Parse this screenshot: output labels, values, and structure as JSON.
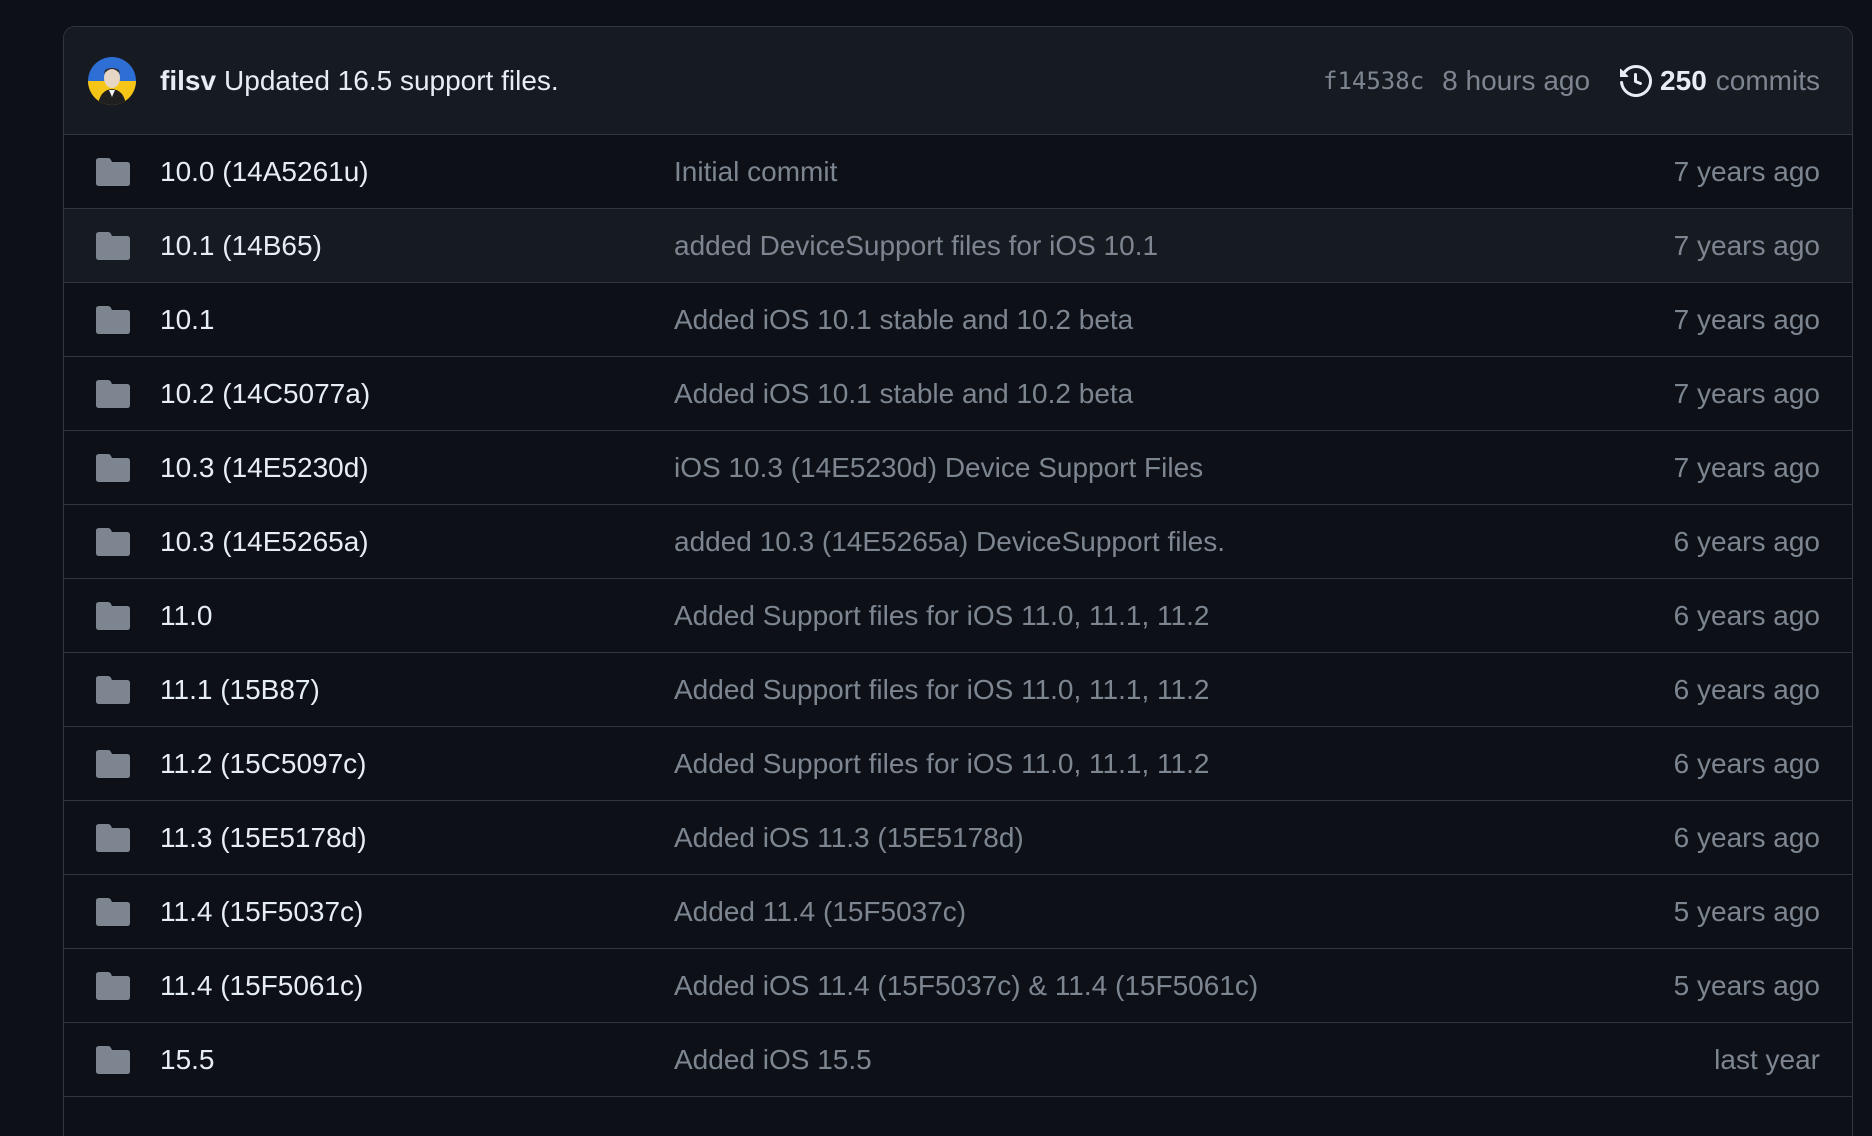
{
  "latest_commit": {
    "author": "filsv",
    "message": "Updated 16.5 support files.",
    "sha": "f14538c",
    "time": "8 hours ago",
    "commit_count": "250",
    "commit_label": "commits",
    "icons": {
      "avatar": "user-avatar",
      "history": "history-icon"
    }
  },
  "colors": {
    "background": "#0d1117",
    "header_background": "#161b22",
    "border": "#30363d",
    "primary_text": "#e6edf3",
    "muted_text": "#7d8590",
    "folder": "#7d8590"
  },
  "files": [
    {
      "name": "10.0 (14A5261u)",
      "message": "Initial commit",
      "age": "7 years ago",
      "icon": "folder-icon"
    },
    {
      "name": "10.1 (14B65)",
      "message": "added DeviceSupport files for iOS 10.1",
      "age": "7 years ago",
      "icon": "folder-icon"
    },
    {
      "name": "10.1",
      "message": "Added iOS 10.1 stable and 10.2 beta",
      "age": "7 years ago",
      "icon": "folder-icon"
    },
    {
      "name": "10.2 (14C5077a)",
      "message": "Added iOS 10.1 stable and 10.2 beta",
      "age": "7 years ago",
      "icon": "folder-icon"
    },
    {
      "name": "10.3 (14E5230d)",
      "message": "iOS 10.3 (14E5230d) Device Support Files",
      "age": "7 years ago",
      "icon": "folder-icon"
    },
    {
      "name": "10.3 (14E5265a)",
      "message": "added 10.3 (14E5265a) DeviceSupport files.",
      "age": "6 years ago",
      "icon": "folder-icon"
    },
    {
      "name": "11.0",
      "message": "Added Support files for iOS 11.0, 11.1, 11.2",
      "age": "6 years ago",
      "icon": "folder-icon"
    },
    {
      "name": "11.1 (15B87)",
      "message": "Added Support files for iOS 11.0, 11.1, 11.2",
      "age": "6 years ago",
      "icon": "folder-icon"
    },
    {
      "name": "11.2 (15C5097c)",
      "message": "Added Support files for iOS 11.0, 11.1, 11.2",
      "age": "6 years ago",
      "icon": "folder-icon"
    },
    {
      "name": "11.3 (15E5178d)",
      "message": "Added iOS 11.3 (15E5178d)",
      "age": "6 years ago",
      "icon": "folder-icon"
    },
    {
      "name": "11.4 (15F5037c)",
      "message": "Added 11.4 (15F5037c)",
      "age": "5 years ago",
      "icon": "folder-icon"
    },
    {
      "name": "11.4 (15F5061c)",
      "message": "Added iOS 11.4 (15F5037c) & 11.4 (15F5061c)",
      "age": "5 years ago",
      "icon": "folder-icon"
    },
    {
      "name": "15.5",
      "message": "Added iOS 15.5",
      "age": "last year",
      "icon": "folder-icon"
    }
  ]
}
